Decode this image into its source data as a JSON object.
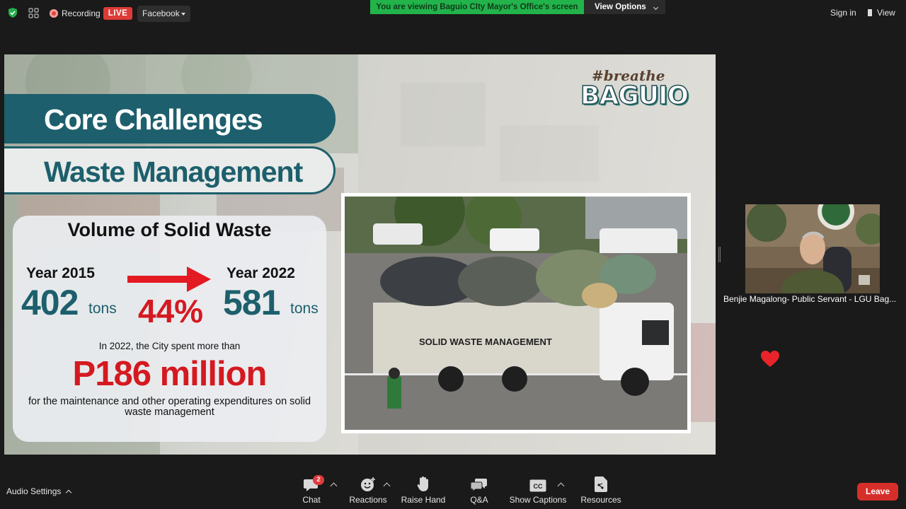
{
  "top_bar": {
    "recording_label": "Recording",
    "live_badge": "LIVE",
    "stream_target": "Facebook",
    "viewing_banner": "You are viewing Baguio CIty Mayor's Office's screen",
    "view_options_label": "View Options",
    "sign_in_label": "Sign in",
    "view_label": "View"
  },
  "slide": {
    "logo_tag": "#breathe",
    "logo_name": "BAGUIO",
    "banner_title": "Core Challenges",
    "banner_subtitle": "Waste Management",
    "card_title": "Volume of Solid Waste",
    "year_2015_label": "Year 2015",
    "year_2015_value": "402",
    "year_2015_unit": "tons",
    "year_2022_label": "Year 2022",
    "year_2022_value": "581",
    "year_2022_unit": "tons",
    "increase": "44%",
    "spent_intro": "In 2022, the City spent more than",
    "spent_amount": "P186 million",
    "spent_purpose": "for the maintenance and other operating expenditures on solid waste management",
    "truck_sign": "SOLID WASTE MANAGEMENT"
  },
  "participant": {
    "name": "Benjie Magalong- Public Servant - LGU Bag..."
  },
  "reaction": {
    "emoji": "❤"
  },
  "bottom_bar": {
    "audio_settings": "Audio Settings",
    "chat_label": "Chat",
    "chat_badge": "2",
    "reactions_label": "Reactions",
    "raise_hand_label": "Raise Hand",
    "qa_label": "Q&A",
    "captions_label": "Show Captions",
    "captions_icon_text": "CC",
    "resources_label": "Resources",
    "leave_label": "Leave"
  },
  "colors": {
    "banner_green": "#22b34a",
    "live_red": "#dc3b36",
    "slide_teal": "#1d5f6c",
    "slide_red": "#d51920",
    "leave_red": "#d62f2a"
  }
}
